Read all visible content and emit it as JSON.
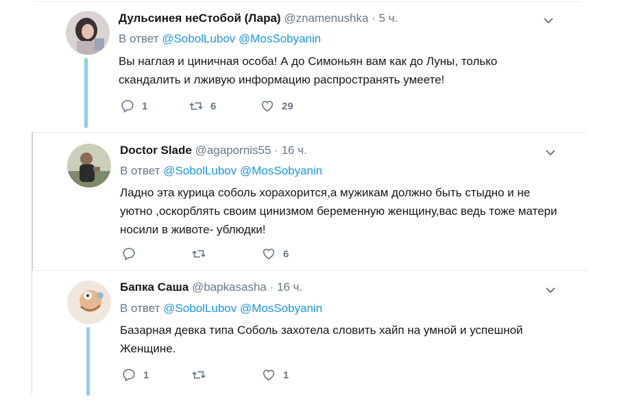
{
  "tweets": [
    {
      "name": "Дульсинея неСтобой (Лара)",
      "handle": "@znamenushka",
      "dot": "·",
      "time": "5 ч.",
      "reply_prefix": "В ответ",
      "reply_to_1": "@SobolLubov",
      "reply_to_2": "@MosSobyanin",
      "text": "Вы наглая  и циничная особа! А до Симоньян вам как до Луны, только скандалить и лживую информацию распространять умеете!",
      "replies": "1",
      "retweets": "6",
      "likes": "29"
    },
    {
      "name": "Doctor Slade",
      "handle": "@agapornis55",
      "dot": "·",
      "time": "16 ч.",
      "reply_prefix": "В ответ",
      "reply_to_1": "@SobolLubov",
      "reply_to_2": "@MosSobyanin",
      "text": "Ладно эта курица соболь хорахорится,а мужикам должно быть стыдно и не уютно ,оскорблять своим цинизмом беременную женщину,вас ведь тоже матери носили в животе- ублюдки!",
      "replies": "",
      "retweets": "",
      "likes": "6"
    },
    {
      "name": "Бапка Саша",
      "handle": "@bapkasasha",
      "dot": "·",
      "time": "16 ч.",
      "reply_prefix": "В ответ",
      "reply_to_1": "@SobolLubov",
      "reply_to_2": "@MosSobyanin",
      "text": "Базарная девка типа Соболь захотела словить хайп на умной и успешной Женщине.",
      "replies": "1",
      "retweets": "",
      "likes": "1"
    }
  ],
  "colors": {
    "link": "#1b95e0",
    "muted": "#657786",
    "thread": "#8ecde8",
    "separator": "#e6ecf0"
  },
  "icons": [
    "reply-icon",
    "retweet-icon",
    "like-icon",
    "chevron-down-icon"
  ]
}
